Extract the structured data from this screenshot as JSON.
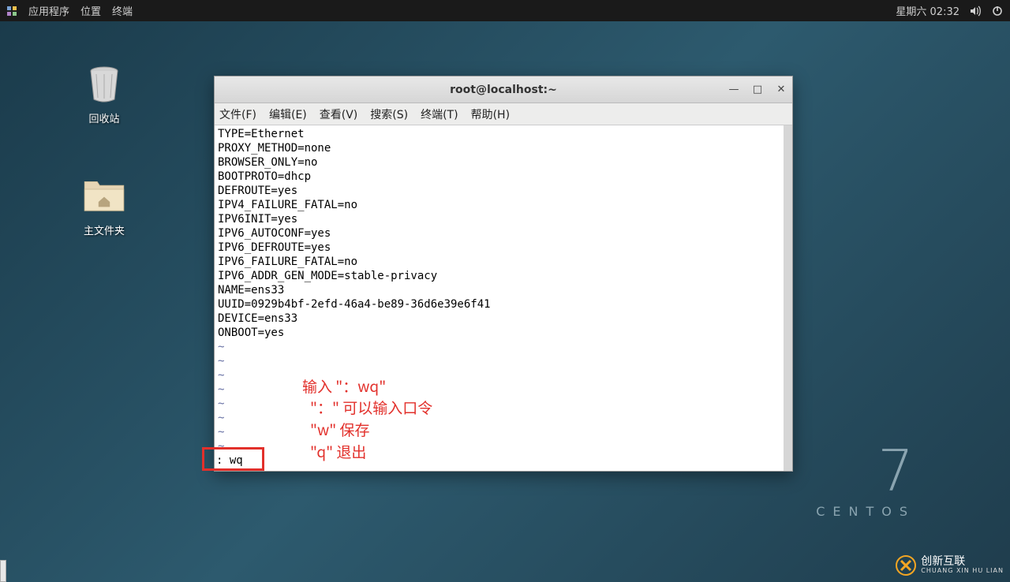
{
  "panel": {
    "apps": "应用程序",
    "places": "位置",
    "terminal": "终端",
    "clock": "星期六 02:32"
  },
  "desktop": {
    "trash": "回收站",
    "home": "主文件夹"
  },
  "terminal": {
    "title": "root@localhost:~",
    "menu": {
      "file": "文件(F)",
      "edit": "编辑(E)",
      "view": "查看(V)",
      "search": "搜索(S)",
      "terminal": "终端(T)",
      "help": "帮助(H)"
    },
    "lines": [
      "TYPE=Ethernet",
      "PROXY_METHOD=none",
      "BROWSER_ONLY=no",
      "BOOTPROTO=dhcp",
      "DEFROUTE=yes",
      "IPV4_FAILURE_FATAL=no",
      "IPV6INIT=yes",
      "IPV6_AUTOCONF=yes",
      "IPV6_DEFROUTE=yes",
      "IPV6_FAILURE_FATAL=no",
      "IPV6_ADDR_GEN_MODE=stable-privacy",
      "NAME=ens33",
      "UUID=0929b4bf-2efd-46a4-be89-36d6e39e6f41",
      "DEVICE=ens33",
      "ONBOOT=yes"
    ],
    "tilde": "~",
    "command": ": wq"
  },
  "annotations": {
    "a1": "输入 \"：wq\"",
    "a2": "\"：\" 可以输入口令",
    "a3": "\"w\" 保存",
    "a4": "\"q\" 退出"
  },
  "brand": {
    "num": "7",
    "name": "CENTOS"
  },
  "watermark": {
    "name": "创新互联",
    "sub": "CHUANG XIN HU LIAN"
  }
}
